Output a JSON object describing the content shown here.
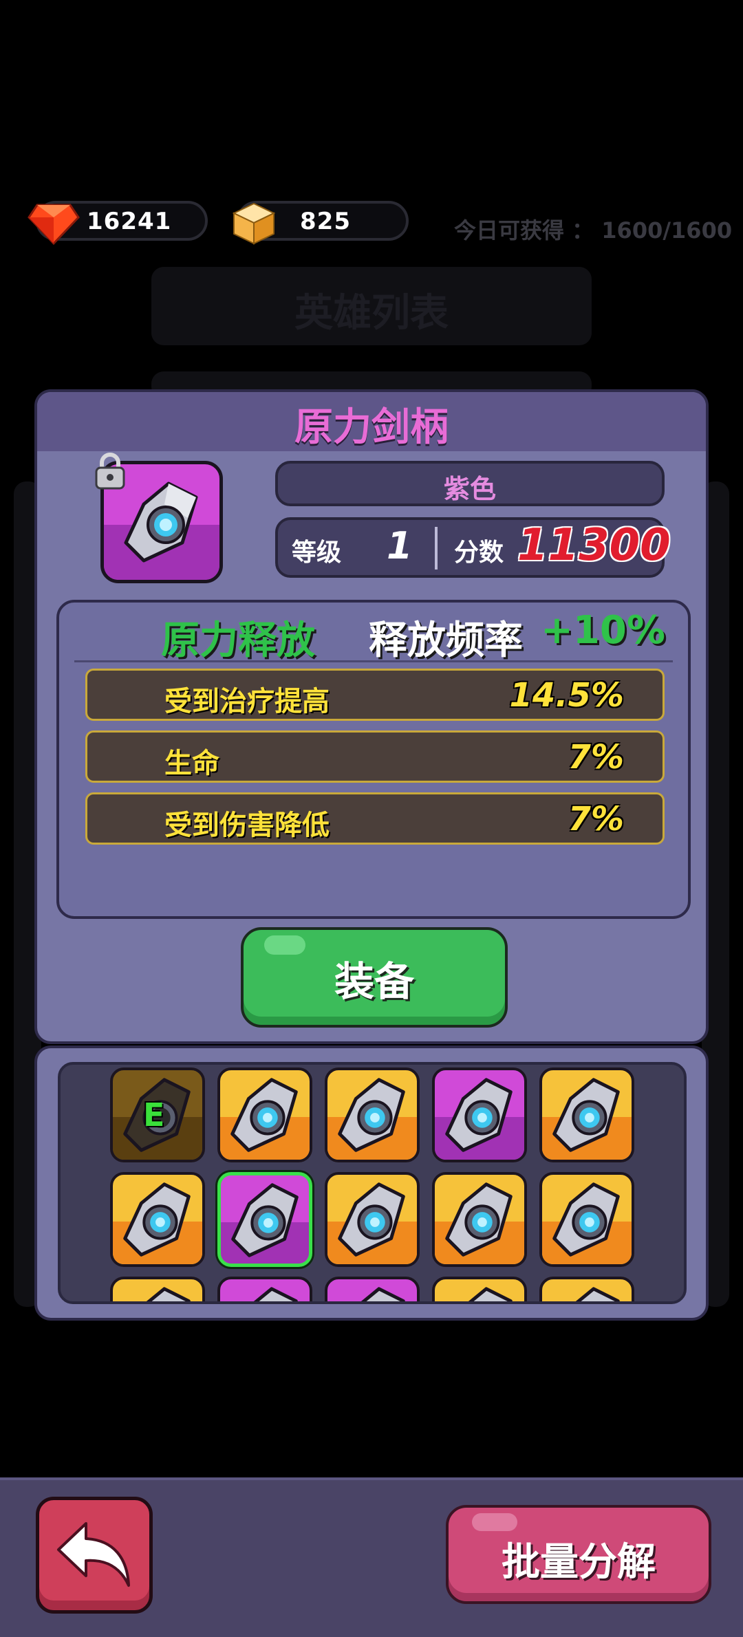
{
  "currency": {
    "gems": "16241",
    "gold": "825",
    "daily_label": "今日可获得 ： 1600/1600"
  },
  "background": {
    "hero_list_title": "英雄列表"
  },
  "item": {
    "name": "原力剑柄",
    "rarity": "紫色",
    "level_label": "等级",
    "level": "1",
    "score_label": "分数",
    "score": "11300",
    "skill_name": "原力释放",
    "skill_effect_label": "释放频率",
    "skill_effect_value": "+10%",
    "stats": [
      {
        "label": "受到治疗提高",
        "value": "14.5%"
      },
      {
        "label": "生命",
        "value": "7%"
      },
      {
        "label": "受到伤害降低",
        "value": "7%"
      }
    ],
    "equip_button": "装备"
  },
  "inventory": {
    "equipped_badge": "E",
    "rows": [
      [
        "dim-equipped",
        "orange",
        "orange",
        "purple",
        "orange"
      ],
      [
        "orange",
        "purple-selected",
        "orange",
        "orange",
        "orange"
      ],
      [
        "orange",
        "purple",
        "purple",
        "orange",
        "orange"
      ]
    ]
  },
  "bottom": {
    "batch_button": "批量分解"
  },
  "colors": {
    "rarity_purple": "#c43fd0",
    "rarity_orange": "#f0a023",
    "score_red": "#e11d2e",
    "stat_yellow": "#ffe23a",
    "skill_green": "#2fc24a"
  }
}
